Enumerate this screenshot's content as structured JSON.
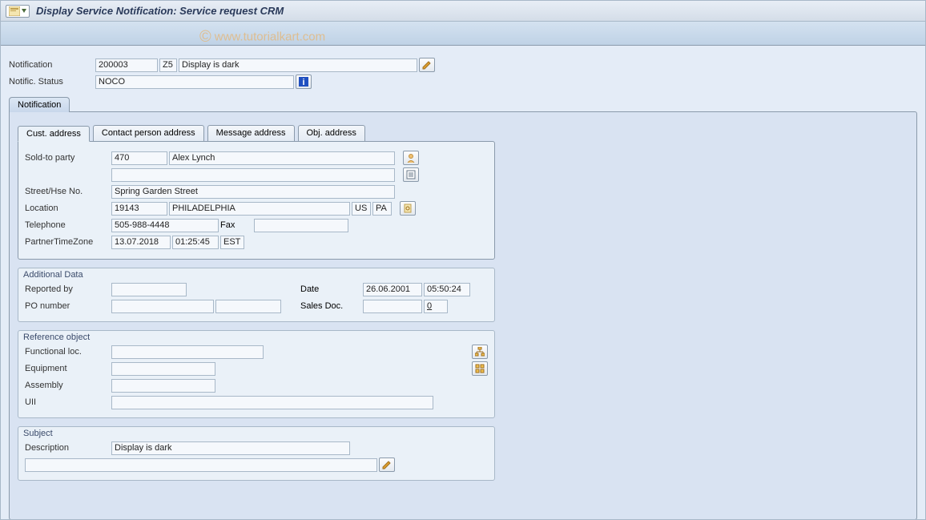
{
  "title": "Display Service Notification: Service request CRM",
  "watermark": "www.tutorialkart.com",
  "header": {
    "notification_label": "Notification",
    "notification_no": "200003",
    "notification_type": "Z5",
    "notification_text": "Display is dark",
    "status_label": "Notific. Status",
    "status_value": "NOCO"
  },
  "main_tab": "Notification",
  "inner_tabs": [
    "Cust. address",
    "Contact person address",
    "Message address",
    "Obj. address"
  ],
  "cust_address": {
    "soldto_label": "Sold-to party",
    "soldto_no": "470",
    "soldto_name": "Alex Lynch",
    "street_label": "Street/Hse No.",
    "street": "Spring Garden Street",
    "location_label": "Location",
    "postcode": "19143",
    "city": "PHILADELPHIA",
    "country": "US",
    "region": "PA",
    "telephone_label": "Telephone",
    "telephone": "505-988-4448",
    "fax_label": "Fax",
    "fax": "",
    "tz_label": "PartnerTimeZone",
    "tz_date": "13.07.2018",
    "tz_time": "01:25:45",
    "tz_zone": "EST"
  },
  "additional": {
    "title": "Additional Data",
    "reportedby_label": "Reported by",
    "reportedby": "",
    "date_label": "Date",
    "date": "26.06.2001",
    "time": "05:50:24",
    "po_label": "PO number",
    "po1": "",
    "po2": "",
    "salesdoc_label": "Sales Doc.",
    "salesdoc": "",
    "salesdoc_item": "0"
  },
  "refobj": {
    "title": "Reference object",
    "funcloc_label": "Functional loc.",
    "funcloc": "",
    "equipment_label": "Equipment",
    "equipment": "",
    "assembly_label": "Assembly",
    "assembly": "",
    "uii_label": "UII",
    "uii": ""
  },
  "subject": {
    "title": "Subject",
    "desc_label": "Description",
    "desc": "Display is dark"
  }
}
